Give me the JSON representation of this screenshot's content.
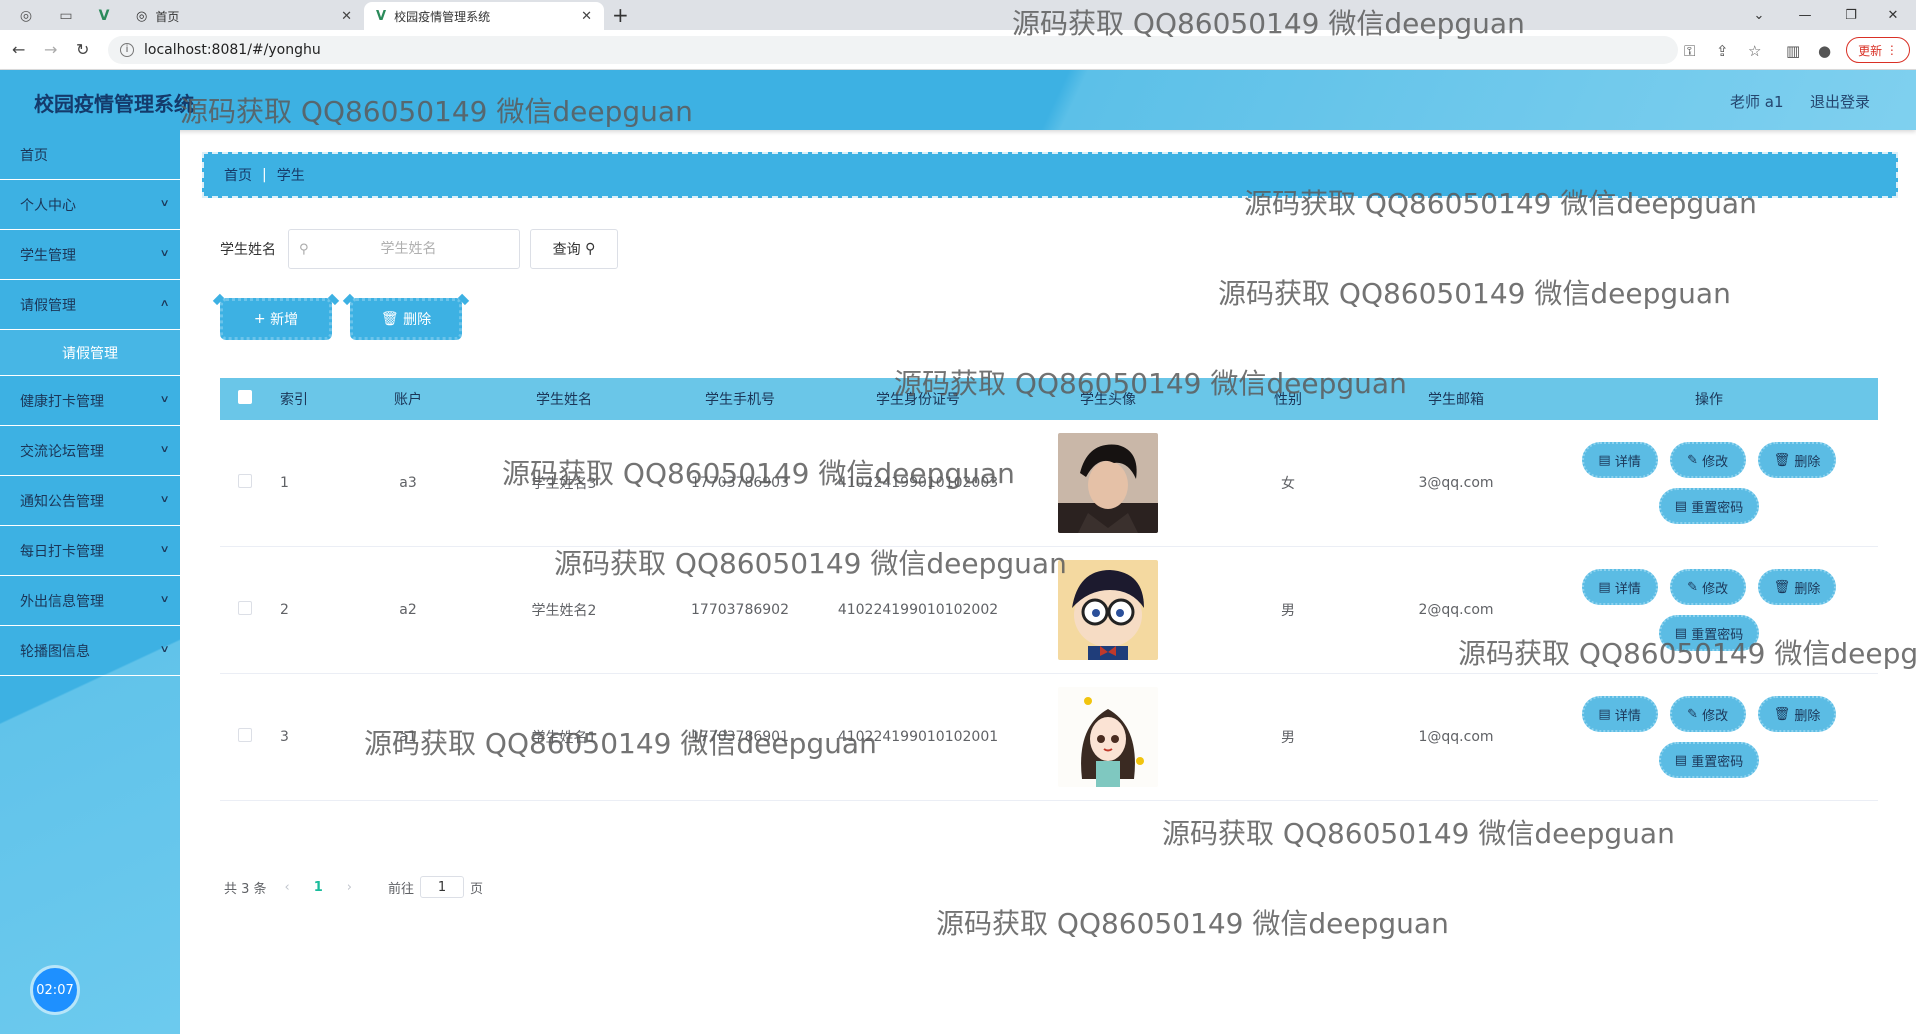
{
  "browser": {
    "tabs": [
      {
        "label": "首页"
      },
      {
        "label": "校园疫情管理系统"
      }
    ],
    "url": "localhost:8081/#/yonghu",
    "update_label": "更新"
  },
  "header": {
    "brand": "校园疫情管理系统",
    "user": "老师 a1",
    "logout": "退出登录"
  },
  "sidebar": {
    "items": [
      {
        "label": "首页"
      },
      {
        "label": "个人中心"
      },
      {
        "label": "学生管理"
      },
      {
        "label": "请假管理"
      },
      {
        "label": "健康打卡管理"
      },
      {
        "label": "交流论坛管理"
      },
      {
        "label": "通知公告管理"
      },
      {
        "label": "每日打卡管理"
      },
      {
        "label": "外出信息管理"
      },
      {
        "label": "轮播图信息"
      }
    ],
    "submenu": {
      "label": "请假管理"
    },
    "clock": "02:07"
  },
  "breadcrumb": {
    "home": "首页",
    "current": "学生"
  },
  "search": {
    "label": "学生姓名",
    "placeholder": "学生姓名",
    "query_label": "查询"
  },
  "actions": {
    "add": "新增",
    "delete": "删除"
  },
  "table": {
    "headers": [
      "索引",
      "账户",
      "学生姓名",
      "学生手机号",
      "学生身份证号",
      "学生头像",
      "性别",
      "学生邮箱",
      "操作"
    ],
    "rows": [
      {
        "index": "1",
        "account": "a3",
        "name": "学生姓名3",
        "phone": "17703786903",
        "id_card": "410224199010102003",
        "gender": "女",
        "email": "3@qq.com"
      },
      {
        "index": "2",
        "account": "a2",
        "name": "学生姓名2",
        "phone": "17703786902",
        "id_card": "410224199010102002",
        "gender": "男",
        "email": "2@qq.com"
      },
      {
        "index": "3",
        "account": "a1",
        "name": "学生姓名1",
        "phone": "17703786901",
        "id_card": "410224199010102001",
        "gender": "男",
        "email": "1@qq.com"
      }
    ],
    "ops": {
      "detail": "详情",
      "edit": "修改",
      "delete": "删除",
      "reset": "重置密码"
    }
  },
  "pager": {
    "total": "共 3 条",
    "page": "1",
    "goto": "前往",
    "page_input": "1",
    "page_unit": "页"
  },
  "watermark": "源码获取 QQ86050149 微信deepguan",
  "colors": {
    "primary": "#3db1e3",
    "table_header": "#6ac6e8",
    "brand_text": "#143a6b"
  }
}
